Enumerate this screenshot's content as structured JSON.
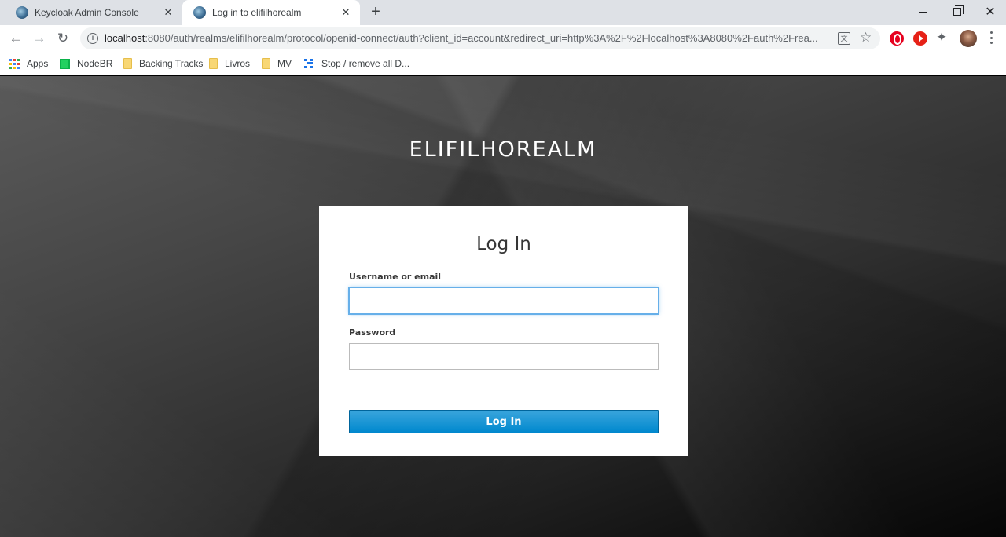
{
  "browser": {
    "tabs": [
      {
        "title": "Keycloak Admin Console",
        "active": false
      },
      {
        "title": "Log in to elifilhorealm",
        "active": true
      }
    ],
    "new_tab": "+",
    "window_controls": {
      "close": "✕"
    },
    "nav": {
      "back": "←",
      "forward": "→",
      "reload": "↻"
    },
    "address_bar": {
      "host": "localhost",
      "rest": ":8080/auth/realms/elifilhorealm/protocol/openid-connect/auth?client_id=account&redirect_uri=http%3A%2F%2Flocalhost%3A8080%2Fauth%2Frea..."
    },
    "icons": {
      "info": "site-info-icon",
      "translate": "translate-icon",
      "star": "bookmark-star-icon",
      "ext1": "opera-extension-icon",
      "ext2": "play-extension-icon",
      "puzzle": "extensions-puzzle-icon",
      "avatar": "profile-avatar",
      "menu": "kebab-menu-icon"
    },
    "bookmarks": [
      {
        "label": "Apps"
      },
      {
        "label": "NodeBR"
      },
      {
        "label": "Backing Tracks"
      },
      {
        "label": "Livros"
      },
      {
        "label": "MV"
      },
      {
        "label": "Stop / remove all D..."
      }
    ]
  },
  "page": {
    "realm_title": "ELIFILHOREALM",
    "card": {
      "title": "Log In",
      "username_label": "Username or email",
      "username_value": "",
      "password_label": "Password",
      "password_value": "",
      "submit_label": "Log In"
    }
  },
  "colors": {
    "button": "#0088ce",
    "focus_ring": "#66afe9",
    "background_dark": "#141414"
  }
}
